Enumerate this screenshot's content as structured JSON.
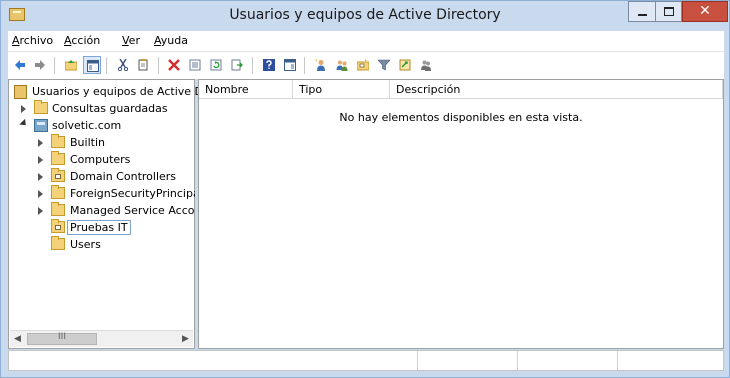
{
  "window": {
    "title": "Usuarios y equipos de Active Directory",
    "close_glyph": "✕",
    "controls": [
      "minimize-icon",
      "maximize-icon",
      "close-icon"
    ],
    "close_color": "#c7503f"
  },
  "menu": {
    "items": [
      {
        "label": "Archivo"
      },
      {
        "label": "Acción"
      },
      {
        "label": "Ver"
      },
      {
        "label": "Ayuda"
      }
    ]
  },
  "toolbar": {
    "buttons": [
      "back-arrow-icon",
      "forward-arrow-icon",
      "up-folder-icon",
      "show-hide-console-tree-icon",
      "cut-icon",
      "copy-icon",
      "delete-icon",
      "properties-icon",
      "refresh-icon",
      "export-list-icon",
      "help-icon",
      "action-pane-icon",
      "new-user-icon",
      "new-group-icon",
      "new-ou-icon",
      "filter-icon",
      "find-icon",
      "add-to-group-icon"
    ]
  },
  "tree": {
    "root": "Usuarios y equipos de Active Dir",
    "saved_queries": "Consultas guardadas",
    "domain": "solvetic.com",
    "children": [
      {
        "label": "Builtin",
        "expandable": true,
        "ou": false
      },
      {
        "label": "Computers",
        "expandable": true,
        "ou": false
      },
      {
        "label": "Domain Controllers",
        "expandable": true,
        "ou": true
      },
      {
        "label": "ForeignSecurityPrincipals",
        "expandable": true,
        "ou": false
      },
      {
        "label": "Managed Service Accour",
        "expandable": true,
        "ou": false
      },
      {
        "label": "Pruebas IT",
        "expandable": false,
        "ou": true,
        "selected": true
      },
      {
        "label": "Users",
        "expandable": false,
        "ou": false
      }
    ],
    "scroll_glyphs": {
      "left": "◀",
      "right": "▶",
      "grip": "III"
    }
  },
  "list": {
    "columns": [
      "Nombre",
      "Tipo",
      "Descripción"
    ],
    "empty_message": "No hay elementos disponibles en esta vista."
  },
  "colors": {
    "chrome": "#c9d9ee",
    "selection_outline": "#7da2ce",
    "folder": "#f3d27a"
  }
}
